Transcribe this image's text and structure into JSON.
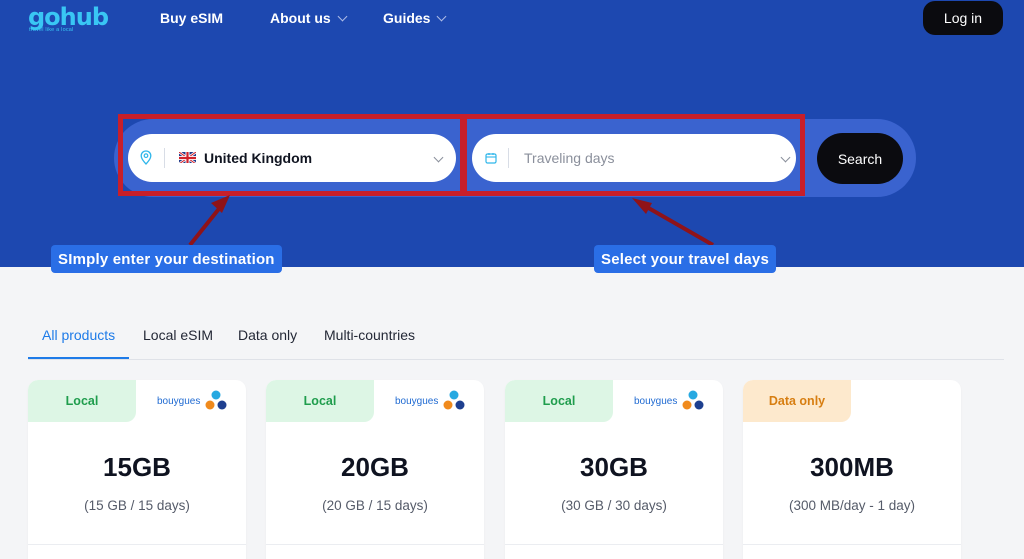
{
  "nav": {
    "logo": "gohub",
    "logo_tagline": "travel like a local",
    "items": [
      {
        "label": "Buy eSIM"
      },
      {
        "label": "About us"
      },
      {
        "label": "Guides"
      }
    ],
    "login_label": "Log in"
  },
  "search": {
    "destination_value": "United Kingdom",
    "days_placeholder": "Traveling days",
    "search_label": "Search"
  },
  "annotations": {
    "destination_callout": "SImply enter your destination",
    "days_callout": "Select your travel days",
    "highlight_color": "#c71f2a",
    "callout_color": "#2a6ee6"
  },
  "tabs": [
    {
      "label": "All products",
      "active": true
    },
    {
      "label": "Local eSIM"
    },
    {
      "label": "Data only"
    },
    {
      "label": "Multi-countries"
    }
  ],
  "cards": [
    {
      "badge": "Local",
      "operator": "bouygues",
      "size": "15GB",
      "desc": "(15 GB / 15 days)"
    },
    {
      "badge": "Local",
      "operator": "bouygues",
      "size": "20GB",
      "desc": "(20 GB / 15 days)"
    },
    {
      "badge": "Local",
      "operator": "bouygues",
      "size": "30GB",
      "desc": "(30 GB / 30 days)"
    },
    {
      "badge": "Data only",
      "size": "300MB",
      "desc": "(300 MB/day - 1 day)"
    }
  ],
  "colors": {
    "hero_bg": "#1d48b0",
    "accent": "#1e7be8",
    "brand_logo": "#39c6f4"
  },
  "icons": [
    "location-pin-icon",
    "uk-flag-icon",
    "calendar-icon",
    "chevron-down-icon",
    "bouygues-logo-icon"
  ]
}
